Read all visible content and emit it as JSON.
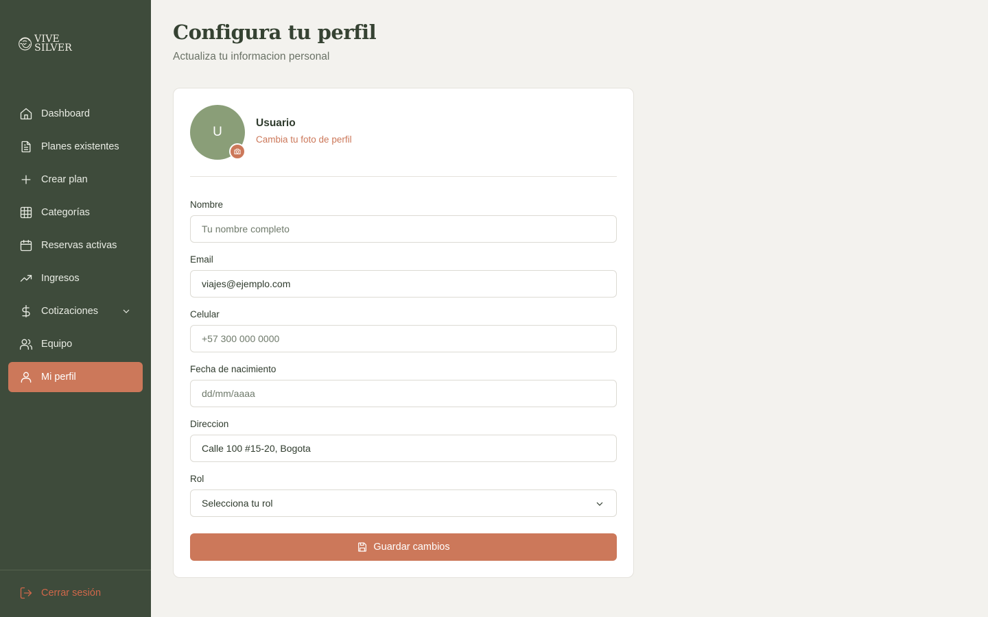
{
  "brand": {
    "line1": "VIVE",
    "line2": "SILVER"
  },
  "sidebar": {
    "items": [
      {
        "label": "Dashboard",
        "icon": "home-icon"
      },
      {
        "label": "Planes existentes",
        "icon": "file-text-icon"
      },
      {
        "label": "Crear plan",
        "icon": "plus-icon"
      },
      {
        "label": "Categorías",
        "icon": "grid-icon"
      },
      {
        "label": "Reservas activas",
        "icon": "calendar-icon"
      },
      {
        "label": "Ingresos",
        "icon": "trending-up-icon"
      },
      {
        "label": "Cotizaciones",
        "icon": "dollar-icon",
        "expandable": true
      },
      {
        "label": "Equipo",
        "icon": "users-icon"
      },
      {
        "label": "Mi perfil",
        "icon": "user-icon",
        "active": true
      }
    ],
    "logout_label": "Cerrar sesión"
  },
  "header": {
    "title": "Configura tu perfil",
    "subtitle": "Actualiza tu informacion personal"
  },
  "profile": {
    "avatar_initial": "U",
    "name": "Usuario",
    "change_photo": "Cambia tu foto de perfil"
  },
  "form": {
    "nombre": {
      "label": "Nombre",
      "placeholder": "Tu nombre completo",
      "value": ""
    },
    "email": {
      "label": "Email",
      "placeholder": "",
      "value": "viajes@ejemplo.com"
    },
    "celular": {
      "label": "Celular",
      "placeholder": "+57 300 000 0000",
      "value": ""
    },
    "fecha": {
      "label": "Fecha de nacimiento",
      "placeholder": "dd/mm/aaaa",
      "value": ""
    },
    "direccion": {
      "label": "Direccion",
      "placeholder": "",
      "value": "Calle 100 #15-20, Bogota"
    },
    "rol": {
      "label": "Rol",
      "selected": "Selecciona tu rol"
    },
    "save_label": "Guardar cambios"
  },
  "colors": {
    "sidebar_bg": "#3e4b3b",
    "accent": "#cc785a",
    "avatar_bg": "#8a9e78",
    "page_bg": "#f3f2ee"
  }
}
